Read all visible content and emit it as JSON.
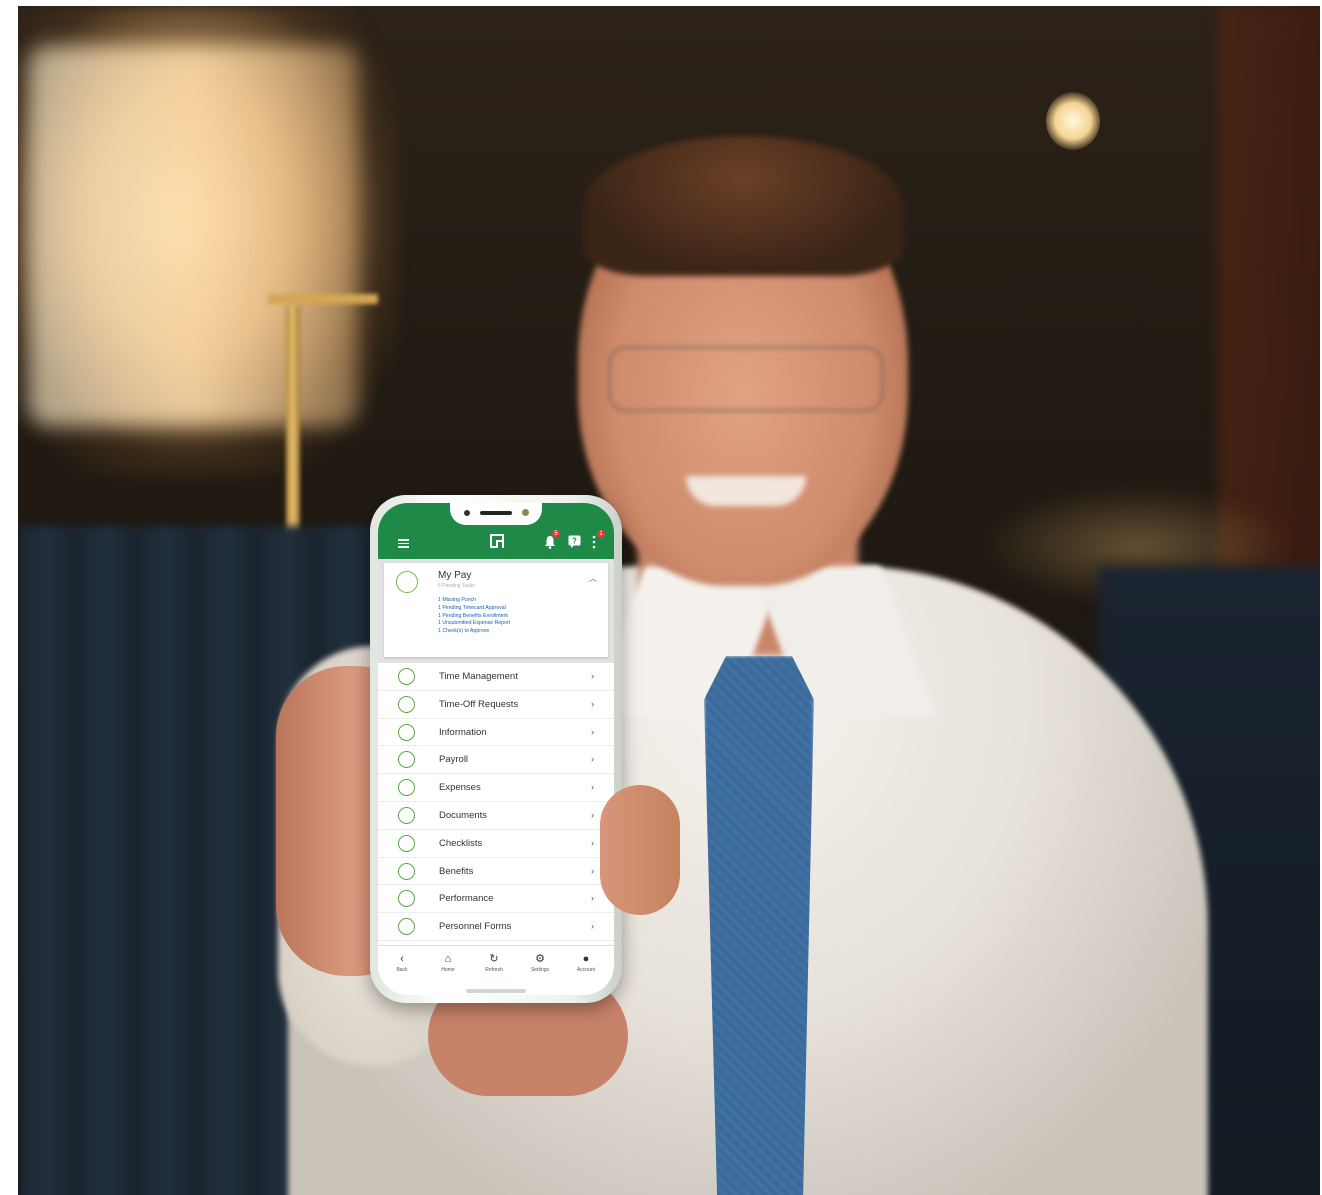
{
  "app": {
    "notifications_badge": "5",
    "more_badge": "1"
  },
  "card": {
    "title": "My Pay",
    "subtitle": "5 Pending Tasks",
    "links": [
      "1 Missing Punch",
      "1 Pending Timecard Approval",
      "1 Pending Benefits Enrollment",
      "1 Unsubmitted Expense Report",
      "1 Check(s) to Approve"
    ]
  },
  "menu": [
    {
      "label": "Time Management",
      "icon": "clock-icon"
    },
    {
      "label": "Time-Off Requests",
      "icon": "calendar-icon"
    },
    {
      "label": "Information",
      "icon": "fingerprint-icon"
    },
    {
      "label": "Payroll",
      "icon": "money-icon"
    },
    {
      "label": "Expenses",
      "icon": "receipt-icon"
    },
    {
      "label": "Documents",
      "icon": "document-icon"
    },
    {
      "label": "Checklists",
      "icon": "check-icon"
    },
    {
      "label": "Benefits",
      "icon": "globe-icon"
    },
    {
      "label": "Performance",
      "icon": "leaf-icon"
    },
    {
      "label": "Personnel Forms",
      "icon": "form-icon"
    }
  ],
  "bottom_nav": [
    {
      "label": "Back",
      "glyph": "‹"
    },
    {
      "label": "Home",
      "glyph": "⌂"
    },
    {
      "label": "Refresh",
      "glyph": "↻"
    },
    {
      "label": "Settings",
      "glyph": "⚙"
    },
    {
      "label": "Account",
      "glyph": "●"
    }
  ],
  "colors": {
    "brand_green": "#1f8a47",
    "link_blue": "#1a5fb4",
    "icon_green": "#5aa845"
  }
}
